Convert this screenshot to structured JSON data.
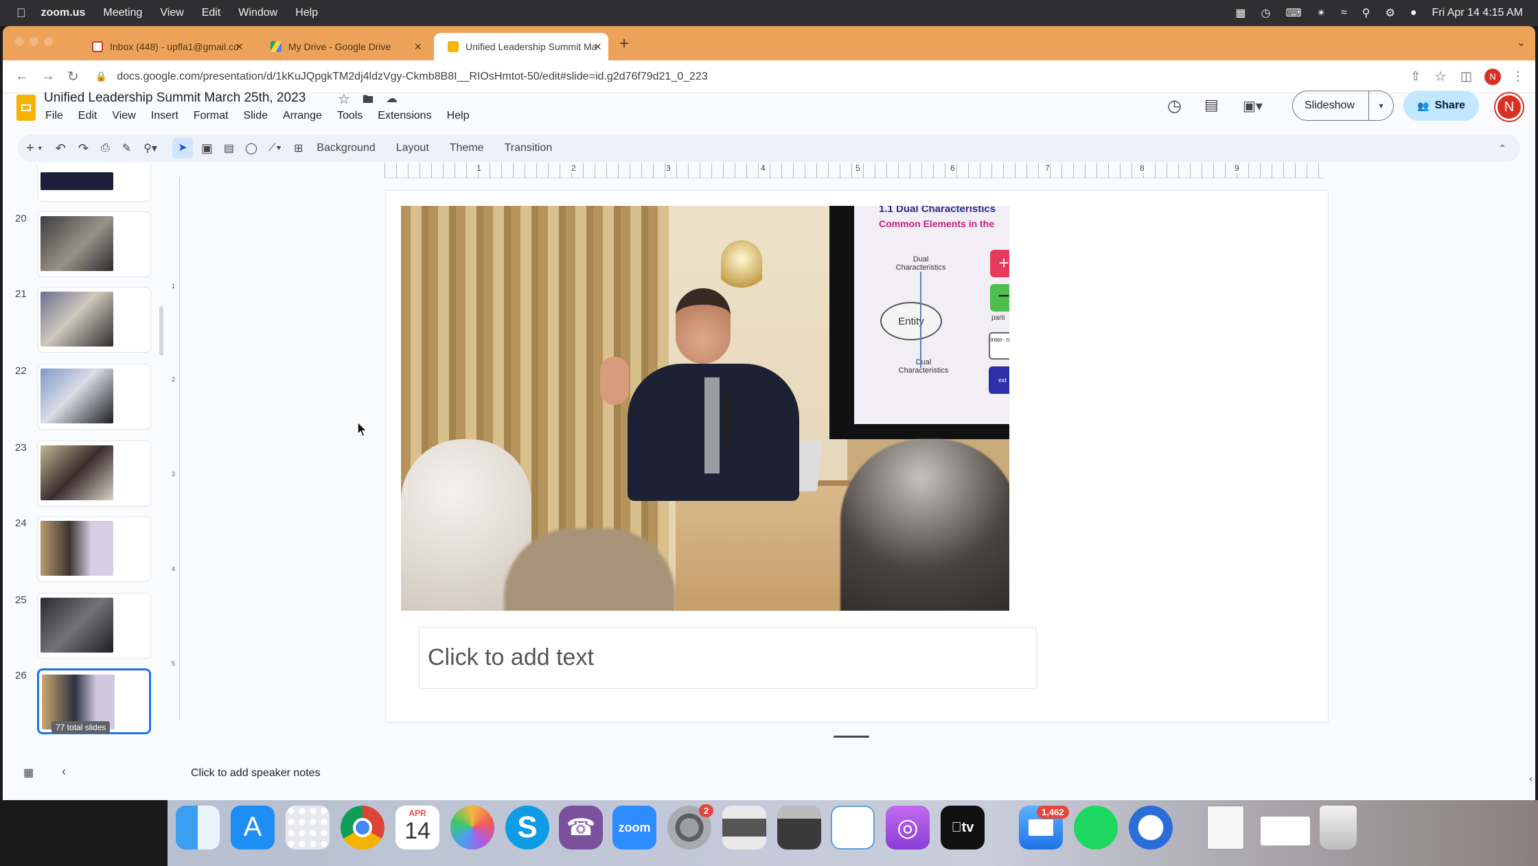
{
  "menubar": {
    "app": "zoom.us",
    "items": [
      "Meeting",
      "View",
      "Edit",
      "Window",
      "Help"
    ],
    "datetime": "Fri Apr 14  4:15 AM"
  },
  "tabs": [
    {
      "label": "Inbox (448) - upfla1@gmail.co"
    },
    {
      "label": "My Drive - Google Drive"
    },
    {
      "label": "Unified Leadership Summit Ma"
    }
  ],
  "address": {
    "url": "docs.google.com/presentation/d/1kKuJQpgkTM2dj4ldzVgy-Ckmb8B8I__RIOsHmtot-50/edit#slide=id.g2d76f79d21_0_223"
  },
  "doc": {
    "title": "Unified Leadership Summit  March 25th, 2023",
    "menu": [
      "File",
      "Edit",
      "View",
      "Insert",
      "Format",
      "Slide",
      "Arrange",
      "Tools",
      "Extensions",
      "Help"
    ],
    "slideshow_label": "Slideshow",
    "share_label": "Share",
    "avatar_letter": "N"
  },
  "toolbar": {
    "background": "Background",
    "layout": "Layout",
    "theme": "Theme",
    "transition": "Transition"
  },
  "filmstrip": {
    "slides": [
      "20",
      "21",
      "22",
      "23",
      "24",
      "25",
      "26"
    ],
    "total_label": "77 total slides"
  },
  "ruler": [
    "1",
    "2",
    "3",
    "4",
    "5",
    "6",
    "7",
    "8",
    "9"
  ],
  "vruler": [
    "1",
    "2",
    "3",
    "4",
    "5"
  ],
  "slide": {
    "screen_heading": "1.1 Dual Characteristics",
    "screen_sub": "Common Elements in the",
    "diagram": {
      "entity": "Entity",
      "dual_top": "Dual Characteristics",
      "dual_bottom": "Dual Characteristics",
      "plus": "+",
      "minus": "−",
      "part": "parti",
      "inner": "inter- nal",
      "ext": "ext"
    },
    "placeholder": "Click to add text"
  },
  "notes": {
    "placeholder": "Click to add speaker notes"
  },
  "dock": {
    "calendar_month": "APR",
    "calendar_day": "14",
    "badge_settings": "2",
    "badge_mail": "1,462"
  },
  "colors": {
    "tabbar": "#eda25a",
    "accent_blue": "#1a73e8",
    "avatar": "#d93025"
  }
}
